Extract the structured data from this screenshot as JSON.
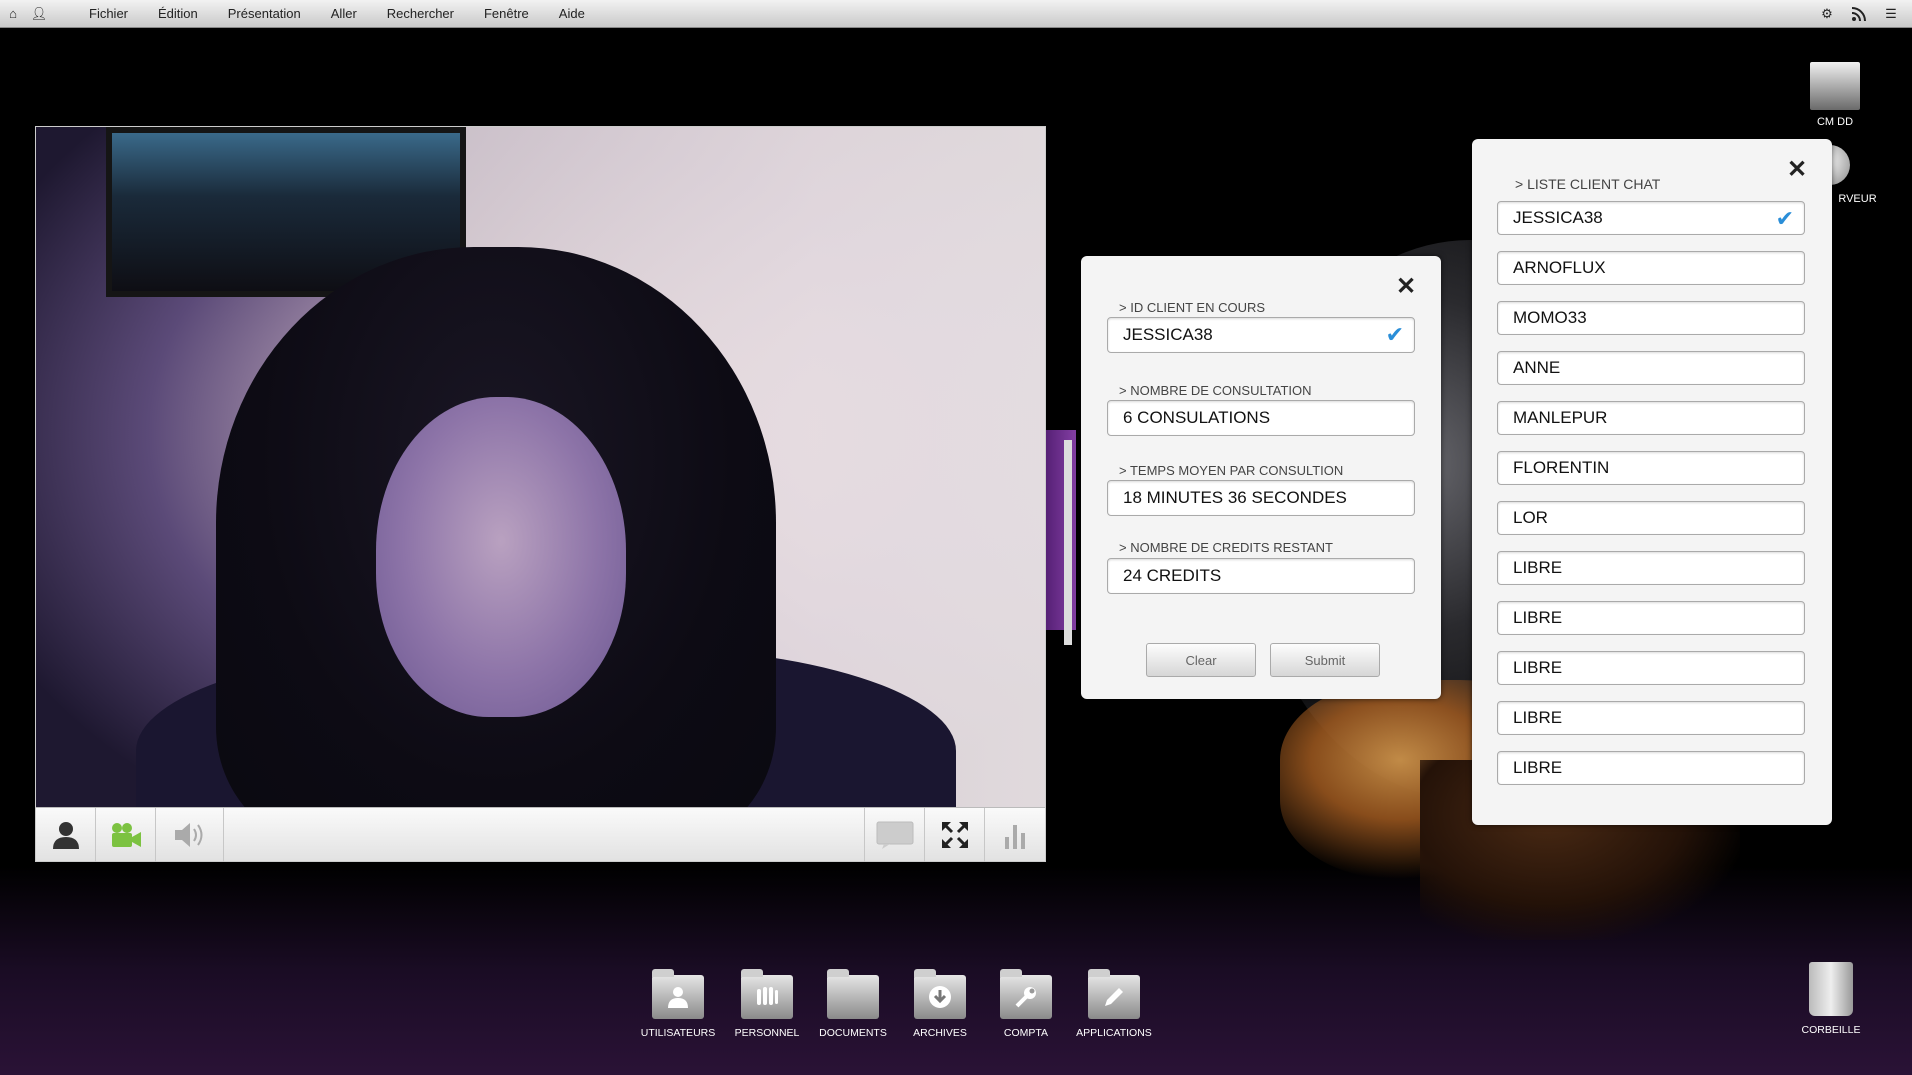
{
  "menubar": {
    "items": [
      "Fichier",
      "Édition",
      "Présentation",
      "Aller",
      "Rechercher",
      "Fenêtre",
      "Aide"
    ],
    "left_icons": [
      "home-icon",
      "user-icon"
    ],
    "right_icons": [
      "gear-icon",
      "rss-icon",
      "list-icon"
    ]
  },
  "desktop_icons": {
    "drive_label": "CM DD",
    "server_label": "RVEUR",
    "trash_label": "CORBEILLE"
  },
  "video_toolbar": {
    "icons": [
      "user-icon",
      "camera-icon",
      "speaker-icon",
      "chat-icon",
      "fullscreen-icon",
      "stats-icon"
    ]
  },
  "client_panel": {
    "id_label": "> ID CLIENT EN COURS",
    "id_value": "JESSICA38",
    "consult_label": "> NOMBRE DE CONSULTATION",
    "consult_value": "6 CONSULATIONS",
    "time_label": "> TEMPS MOYEN PAR CONSULTION",
    "time_value": "18 MINUTES 36 SECONDES",
    "credits_label": "> NOMBRE DE CREDITS RESTANT",
    "credits_value": "24 CREDITS",
    "clear_label": "Clear",
    "submit_label": "Submit"
  },
  "chat_list": {
    "title": "> LISTE CLIENT CHAT",
    "clients": [
      "JESSICA38",
      "ARNOFLUX",
      "MOMO33",
      "ANNE",
      "MANLEPUR",
      "FLORENTIN",
      "LOR",
      "LIBRE",
      "LIBRE",
      "LIBRE",
      "LIBRE",
      "LIBRE"
    ],
    "selected": "JESSICA38"
  },
  "dock": {
    "items": [
      "UTILISATEURS",
      "PERSONNEL",
      "DOCUMENTS",
      "ARCHIVES",
      "COMPTA",
      "APPLICATIONS"
    ]
  },
  "colors": {
    "accent_check": "#2a8ed8",
    "camera_green": "#7cc241",
    "bottom_purple": "#2a1236"
  }
}
